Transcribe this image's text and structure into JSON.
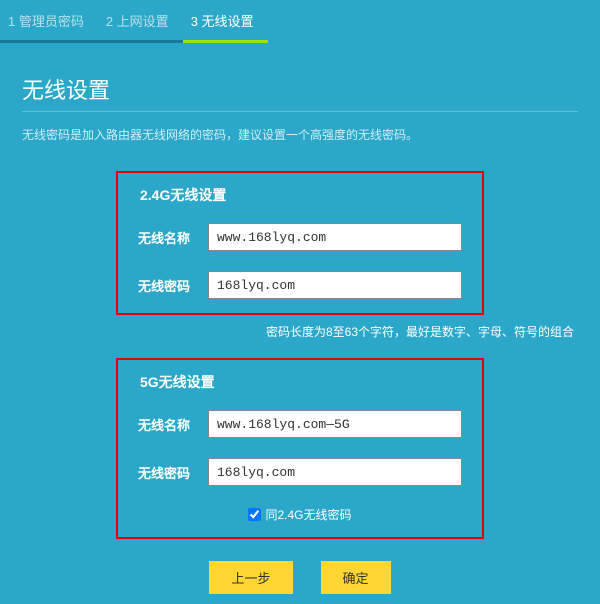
{
  "steps": [
    {
      "label": "1 管理员密码"
    },
    {
      "label": "2 上网设置"
    },
    {
      "label": "3 无线设置"
    }
  ],
  "activeStep": 2,
  "title": "无线设置",
  "desc": "无线密码是加入路由器无线网络的密码，建议设置一个高强度的无线密码。",
  "g24": {
    "title": "2.4G无线设置",
    "nameLabel": "无线名称",
    "nameValue": "www.168lyq.com",
    "passLabel": "无线密码",
    "passValue": "168lyq.com"
  },
  "hint": "密码长度为8至63个字符，最好是数字、字母、符号的组合",
  "g5": {
    "title": "5G无线设置",
    "nameLabel": "无线名称",
    "nameValue": "www.168lyq.com—5G",
    "passLabel": "无线密码",
    "passValue": "168lyq.com",
    "sameLabel": "同2.4G无线密码"
  },
  "btnPrev": "上一步",
  "btnOk": "确定"
}
